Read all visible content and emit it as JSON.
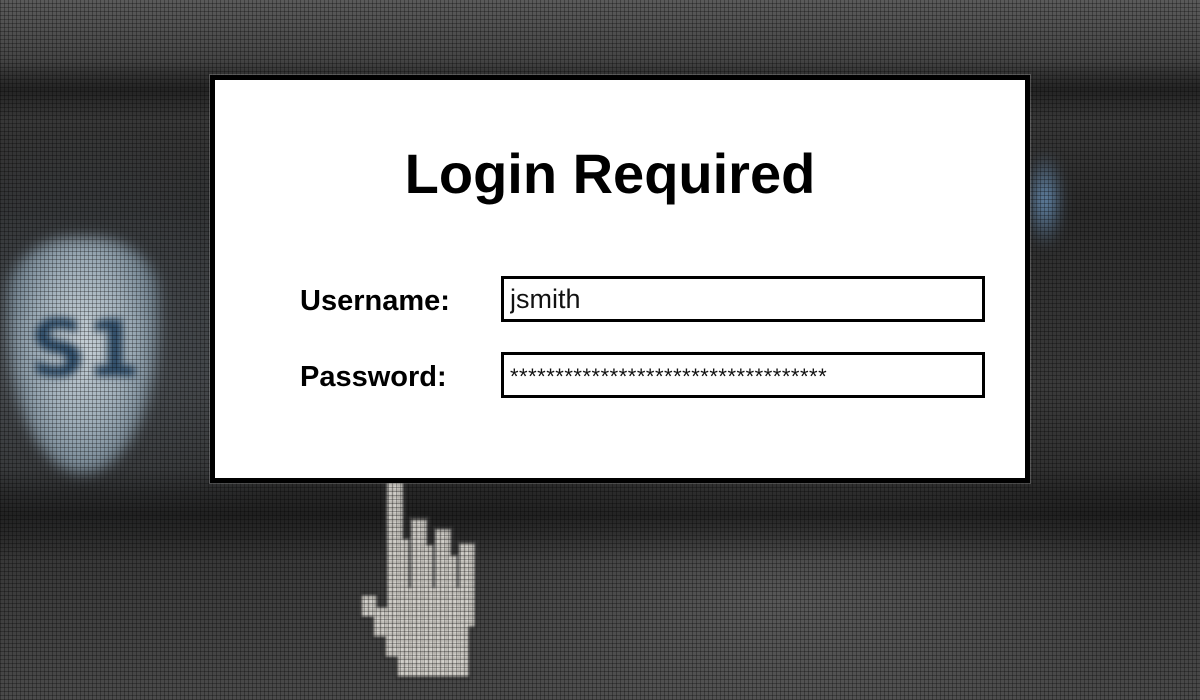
{
  "login": {
    "title": "Login Required",
    "username_label": "Username:",
    "username_value": "jsmith",
    "password_label": "Password:",
    "password_value": "***********************************"
  },
  "background": {
    "shield_glyph": "S1",
    "icons": [
      "shield-badge",
      "hand-pointer-cursor"
    ]
  }
}
